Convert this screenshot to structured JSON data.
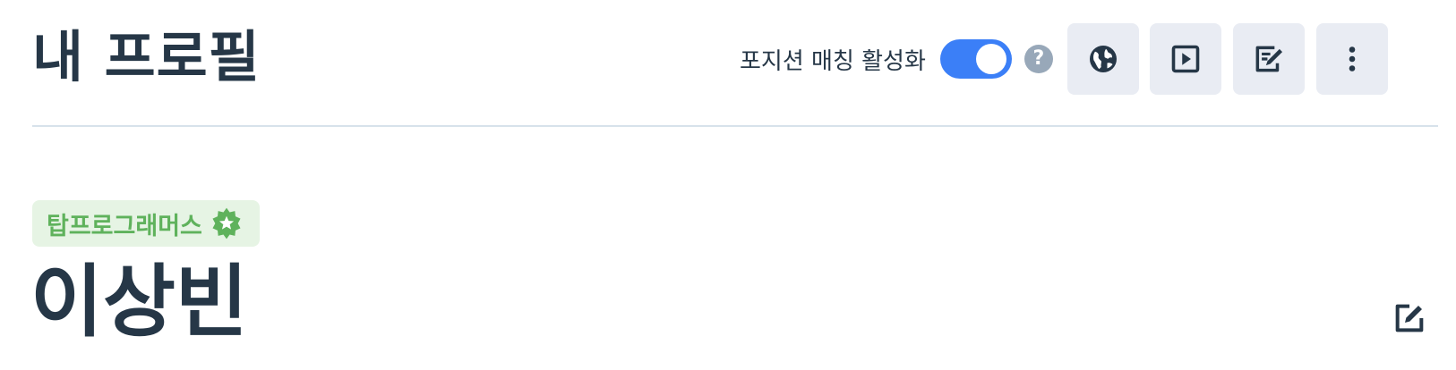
{
  "header": {
    "title": "내 프로필",
    "position_matching": {
      "label": "포지션 매칭 활성화",
      "enabled": true,
      "help_symbol": "?"
    },
    "actions": [
      {
        "icon": "globe-icon"
      },
      {
        "icon": "play-icon"
      },
      {
        "icon": "edit-document-icon"
      },
      {
        "icon": "more-vertical-icon"
      }
    ]
  },
  "profile": {
    "badge": {
      "label": "탑프로그래머스",
      "icon": "star-seal-icon",
      "color": "#5fb25c",
      "background": "#e6f4e4"
    },
    "name": "이상빈",
    "edit_icon": "pencil-edit-icon"
  },
  "colors": {
    "toggle_on": "#3b7ff7",
    "text_primary": "#263747",
    "divider": "#d7e2eb",
    "help_icon": "#98a8b9",
    "button_bg": "#e9ecf3"
  }
}
